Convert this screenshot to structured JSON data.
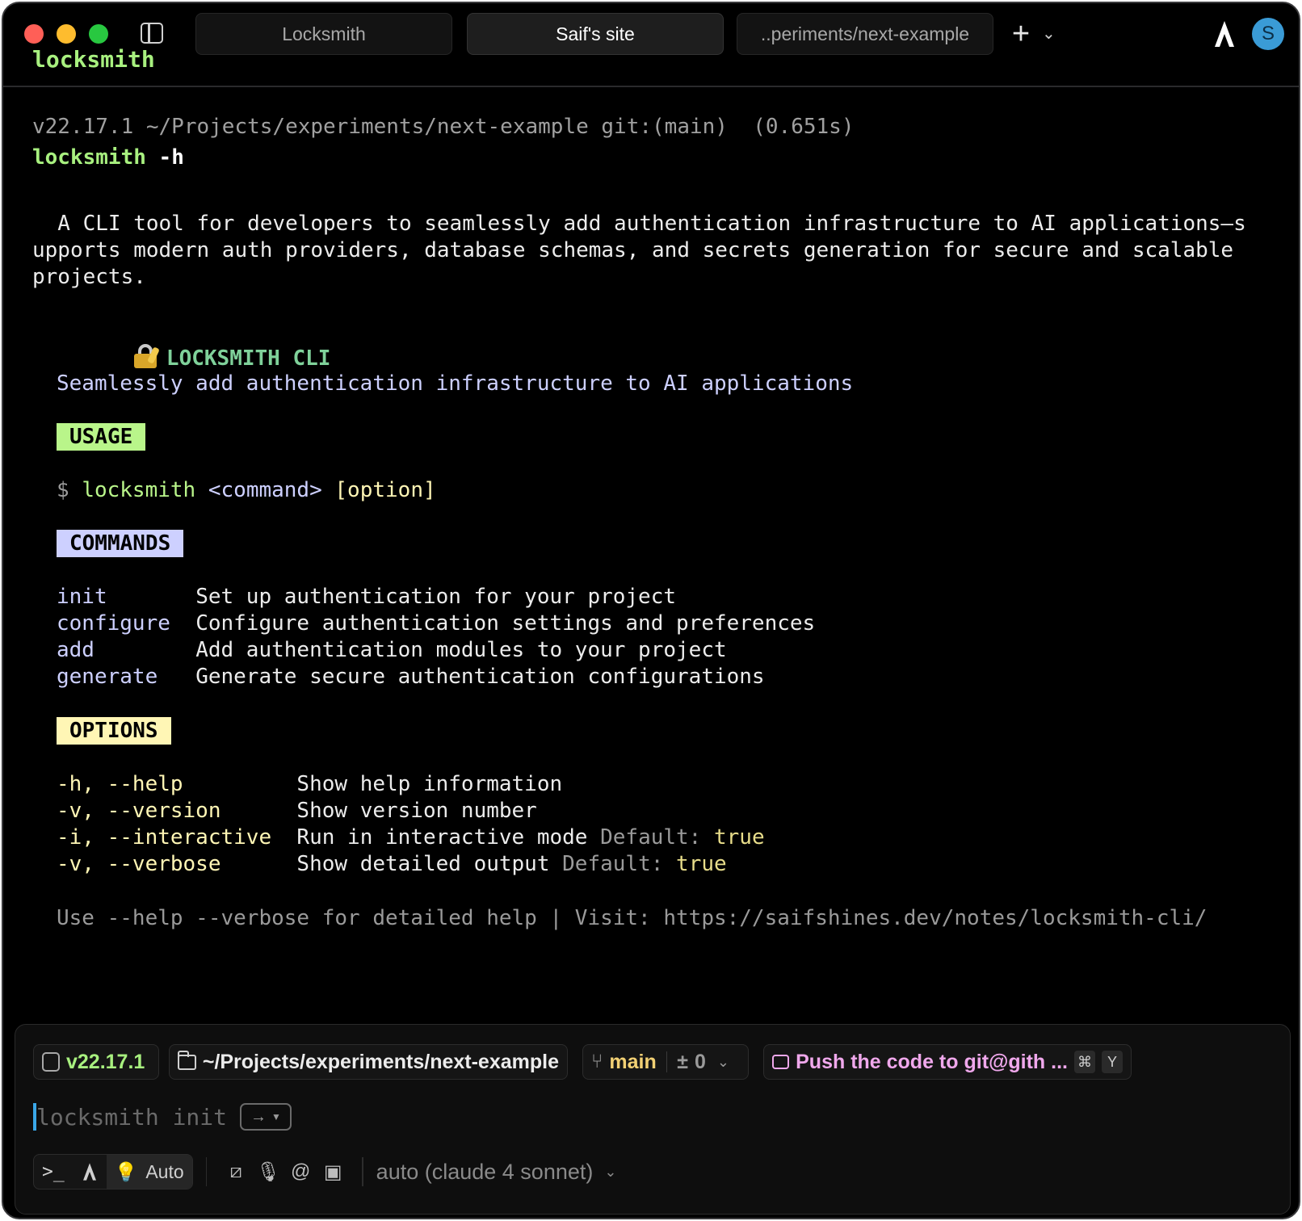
{
  "titlebar": {
    "tabs": [
      {
        "label": "Locksmith"
      },
      {
        "label": "Saif's site"
      },
      {
        "label": "..periments/next-example"
      }
    ],
    "add_tab": "+",
    "avatar_initial": "S",
    "scrolled_heading": "locksmith"
  },
  "terminal": {
    "prompt": "v22.17.1 ~/Projects/experiments/next-example git:(main)  (0.651s)",
    "command": "locksmith",
    "command_flag": " -h",
    "description_lines": [
      "  A CLI tool for developers to seamlessly add authentication infrastructure to AI applications—s",
      "upports modern auth providers, database schemas, and secrets generation for secure and scalable",
      "projects."
    ],
    "title": "LOCKSMITH CLI",
    "tagline": "Seamlessly add authentication infrastructure to AI applications",
    "usage_label": "USAGE",
    "usage": {
      "dollar": "$ ",
      "cmd": "locksmith ",
      "arg": "<command> ",
      "opt": "[option]"
    },
    "commands_label": "COMMANDS",
    "commands": [
      {
        "name": "init       ",
        "desc": "Set up authentication for your project"
      },
      {
        "name": "configure  ",
        "desc": "Configure authentication settings and preferences"
      },
      {
        "name": "add        ",
        "desc": "Add authentication modules to your project"
      },
      {
        "name": "generate   ",
        "desc": "Generate secure authentication configurations"
      }
    ],
    "options_label": "OPTIONS",
    "options": [
      {
        "flag": "-h, --help         ",
        "desc": "Show help information",
        "default_label": "",
        "default_value": ""
      },
      {
        "flag": "-v, --version      ",
        "desc": "Show version number",
        "default_label": "",
        "default_value": ""
      },
      {
        "flag": "-i, --interactive  ",
        "desc": "Run in interactive mode",
        "default_label": " Default: ",
        "default_value": "true"
      },
      {
        "flag": "-v, --verbose      ",
        "desc": "Show detailed output",
        "default_label": " Default: ",
        "default_value": "true"
      }
    ],
    "footer": "Use --help --verbose for detailed help | Visit: https://saifshines.dev/notes/locksmith-cli/"
  },
  "input_panel": {
    "node_version": "v22.17.1",
    "directory": "~/Projects/experiments/next-example",
    "branch": "main",
    "diff_symbol": "±",
    "diff_count": "0",
    "suggestion": "Push the code to git@gith ...",
    "suggestion_keys": [
      "⌘",
      "Y"
    ],
    "input_placeholder": "locksmith init",
    "mode_arrow": "→",
    "auto_label": "Auto",
    "model": "auto (claude 4 sonnet)"
  }
}
